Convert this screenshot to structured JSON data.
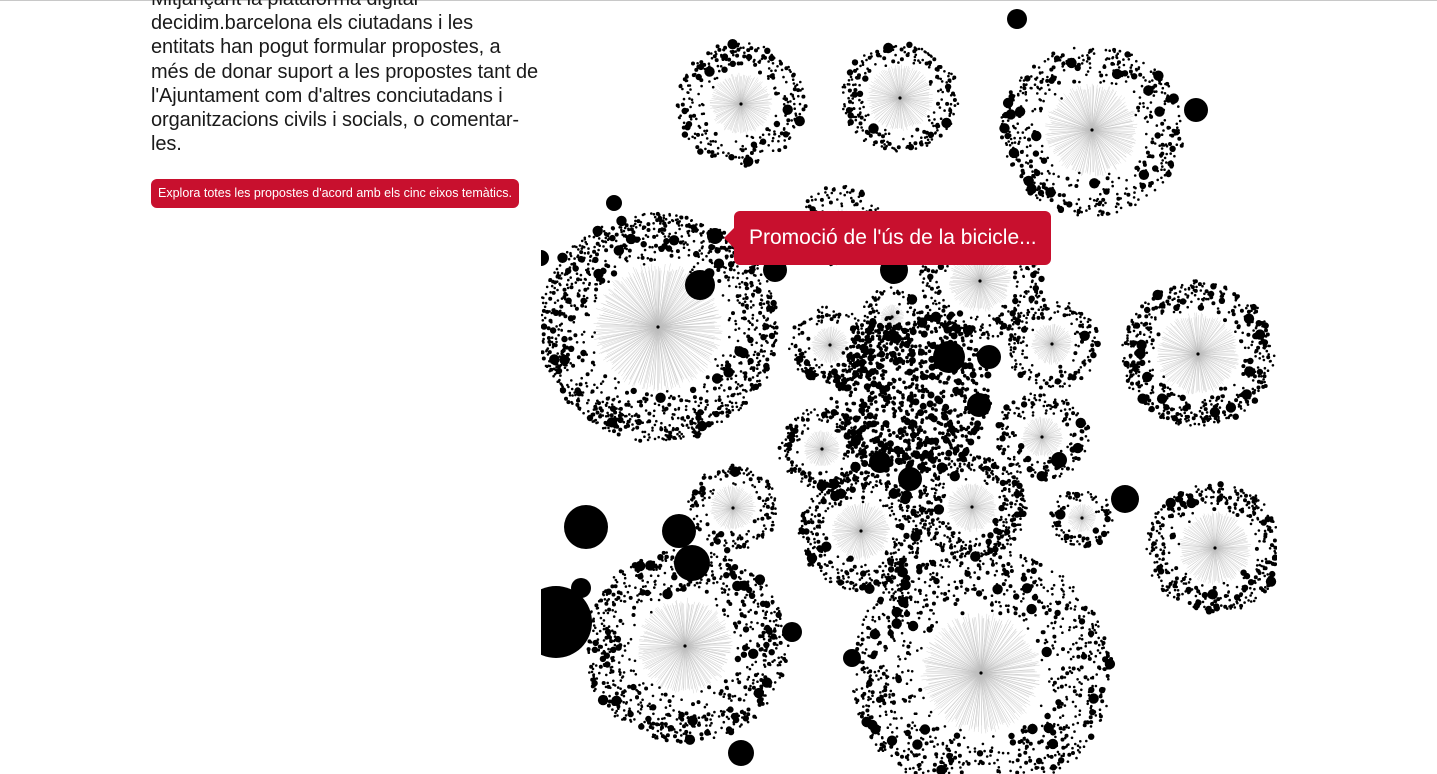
{
  "intro": {
    "paragraph": "Mitjançant la plataforma digital decidim.barcelona els ciutadans i les entitats han pogut formular propostes, a més de donar suport a les propostes tant de l'Ajuntament com d'altres conciutadans i organitzacions civils i socials, o comentar-les."
  },
  "explore_button": {
    "label": "Explora totes les propostes d'acord amb els cinc eixos temàtics."
  },
  "tooltip": {
    "label": "Promoció de l'ús de la bicicle..."
  },
  "colors": {
    "accent": "#c8102e",
    "node": "#000000",
    "edge": "#bdbdbd",
    "text": "#1a1a1a"
  }
}
